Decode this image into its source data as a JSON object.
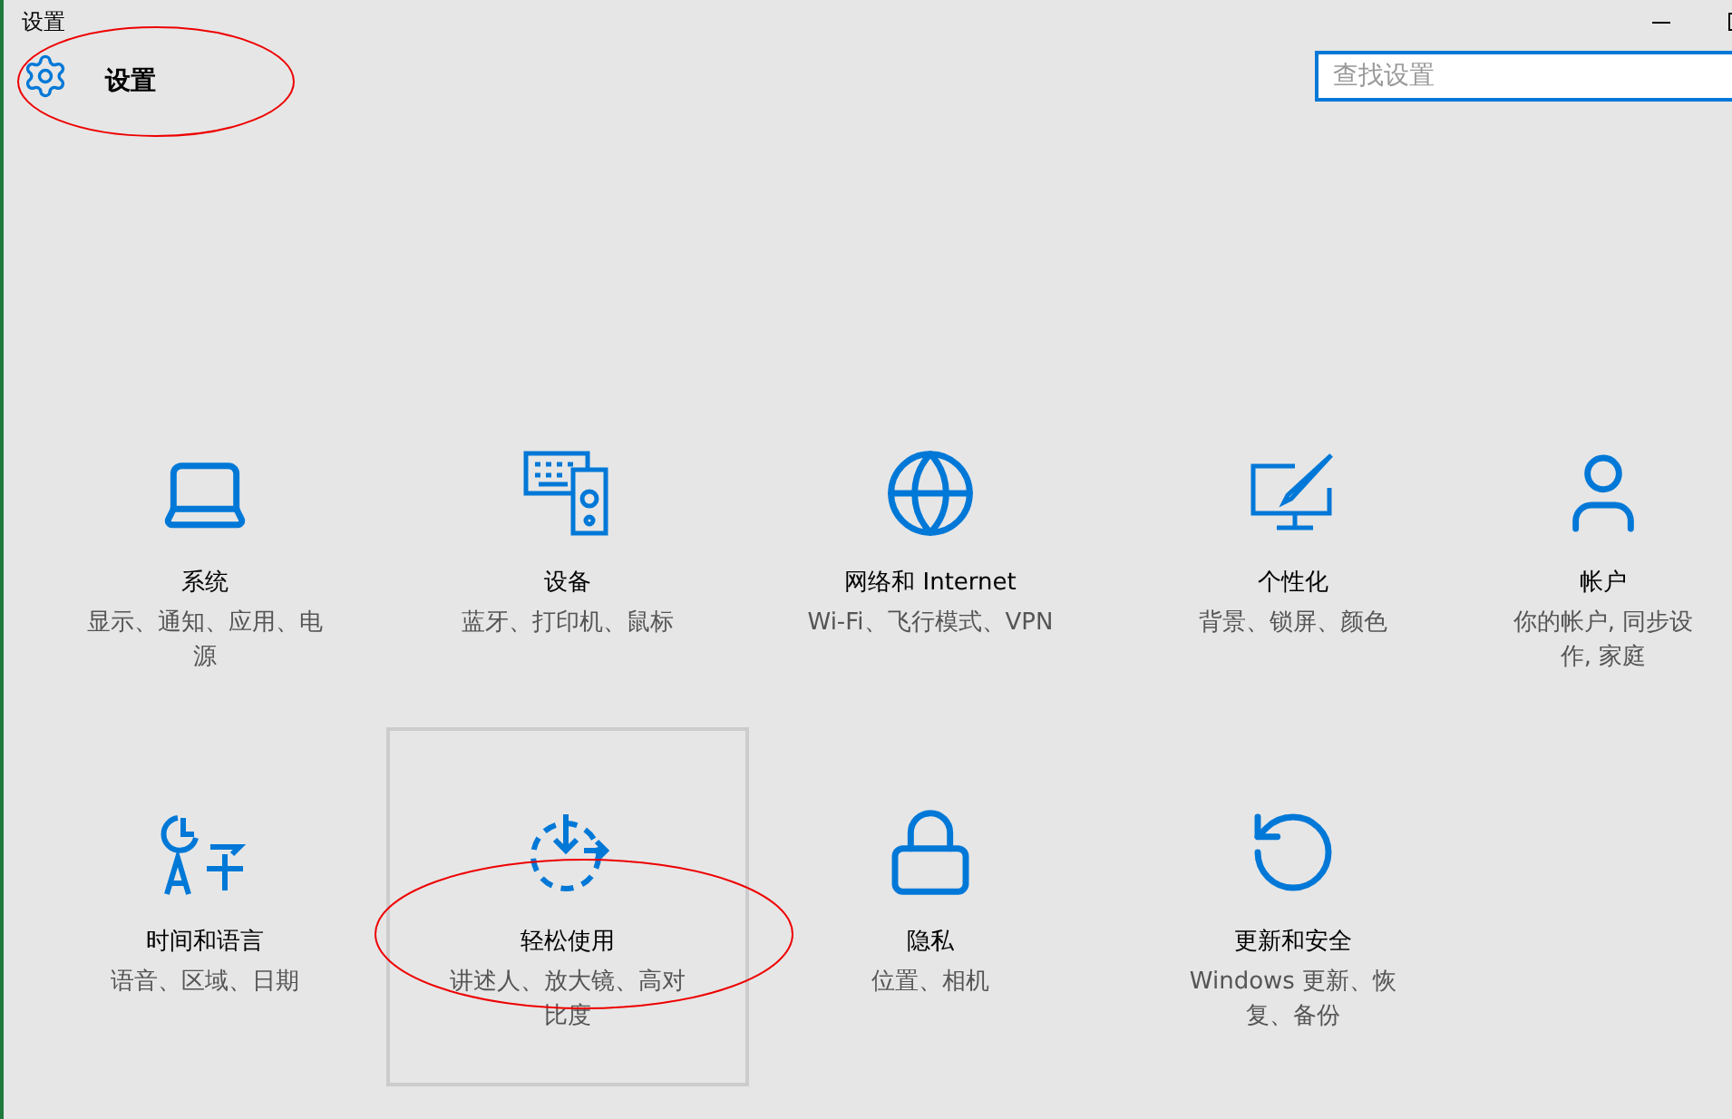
{
  "window": {
    "title": "设置"
  },
  "header": {
    "title": "设置"
  },
  "search": {
    "placeholder": "查找设置"
  },
  "tiles": [
    {
      "title": "系统",
      "description_lines": [
        "显示、通知、应用、电",
        "源"
      ],
      "hovered": false
    },
    {
      "title": "设备",
      "description_lines": [
        "蓝牙、打印机、鼠标"
      ],
      "hovered": false
    },
    {
      "title": "网络和 Internet",
      "description_lines": [
        "Wi-Fi、飞行模式、VPN"
      ],
      "hovered": false
    },
    {
      "title": "个性化",
      "description_lines": [
        "背景、锁屏、颜色"
      ],
      "hovered": false
    },
    {
      "title": "帐户",
      "description_lines": [
        "你的帐户, 同步设",
        "作, 家庭"
      ],
      "hovered": false
    },
    {
      "title": "时间和语言",
      "description_lines": [
        "语音、区域、日期"
      ],
      "hovered": false
    },
    {
      "title": "轻松使用",
      "description_lines": [
        "讲述人、放大镜、高对",
        "比度"
      ],
      "hovered": true
    },
    {
      "title": "隐私",
      "description_lines": [
        "位置、相机"
      ],
      "hovered": false
    },
    {
      "title": "更新和安全",
      "description_lines": [
        "Windows 更新、恢",
        "复、备份"
      ],
      "hovered": false
    }
  ]
}
